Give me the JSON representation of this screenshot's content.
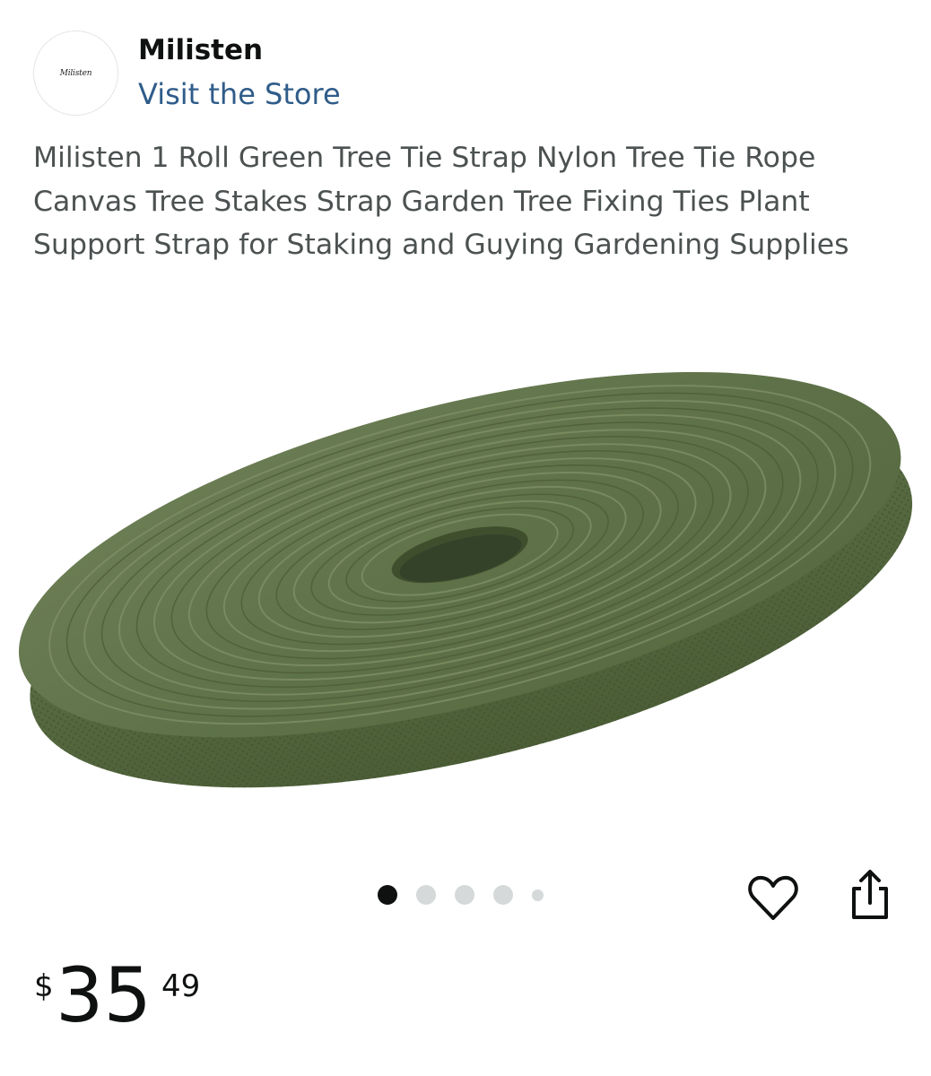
{
  "store": {
    "logo_text": "Milisten",
    "name": "Milisten",
    "link_label": "Visit the Store"
  },
  "product": {
    "title": "Milisten 1 Roll Green Tree Tie Strap Nylon Tree Tie Rope Canvas Tree Stakes Strap Garden Tree Fixing Ties Plant Support Strap for Staking and Guying Gardening Supplies",
    "image_icon": "green-strap-roll",
    "image_color": "#5b6e45"
  },
  "carousel": {
    "total_dots": 5,
    "active_index": 0
  },
  "actions": {
    "favorite_icon": "heart-icon",
    "share_icon": "share-icon"
  },
  "price": {
    "symbol": "$",
    "whole": "35",
    "fraction": "49"
  },
  "colors": {
    "link": "#2f5c8a",
    "text": "#0f1111",
    "title": "#4c5151"
  }
}
